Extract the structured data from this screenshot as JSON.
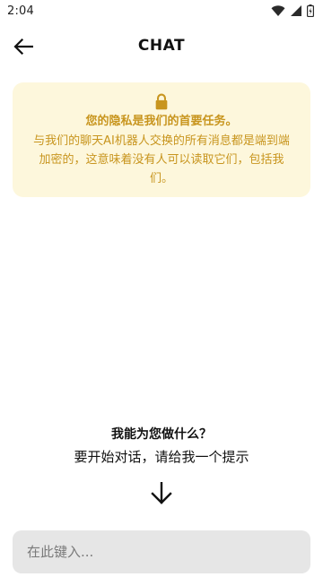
{
  "status_bar": {
    "time": "2:04",
    "icons": [
      "wifi-icon",
      "cell-signal-icon",
      "battery-icon"
    ]
  },
  "app_bar": {
    "title": "CHAT",
    "back_icon": "arrow-left-icon"
  },
  "privacy_card": {
    "icon": "lock-icon",
    "heading": "您的隐私是我们的首要任务。",
    "body": "与我们的聊天AI机器人交换的所有消息都是端到端加密的，这意味着没有人可以读取它们，包括我们。",
    "background_color": "#fdf7dc",
    "text_color": "#c8951e"
  },
  "prompt": {
    "question": "我能为您做什么？",
    "hint": "要开始对话，请给我一个提示",
    "arrow_icon": "arrow-down-icon"
  },
  "input": {
    "placeholder": "在此键入...",
    "value": ""
  }
}
